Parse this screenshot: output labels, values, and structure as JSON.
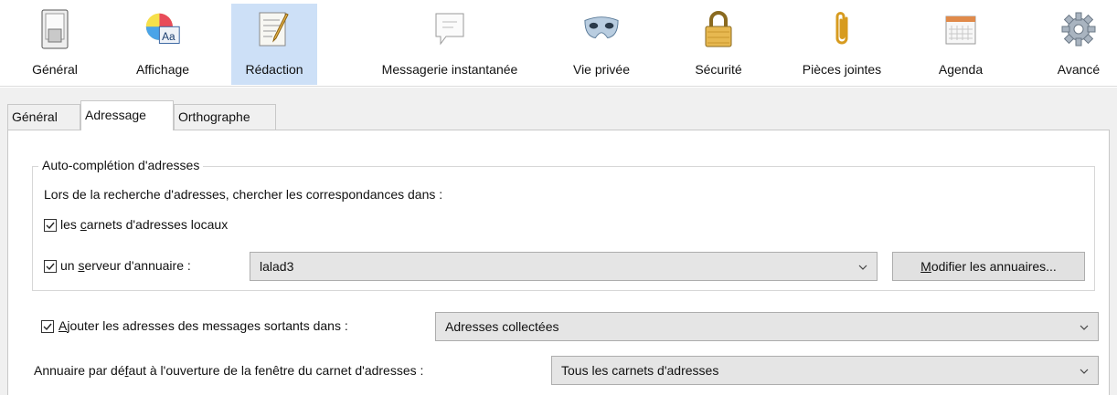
{
  "toolbar": {
    "items": [
      {
        "label": "Général",
        "icon": "general-icon"
      },
      {
        "label": "Affichage",
        "icon": "display-icon"
      },
      {
        "label": "Rédaction",
        "icon": "composition-icon",
        "selected": true
      },
      {
        "label": "Messagerie instantanée",
        "icon": "chat-icon"
      },
      {
        "label": "Vie privée",
        "icon": "privacy-mask-icon"
      },
      {
        "label": "Sécurité",
        "icon": "security-lock-icon"
      },
      {
        "label": "Pièces jointes",
        "icon": "attachment-clip-icon"
      },
      {
        "label": "Agenda",
        "icon": "calendar-icon"
      },
      {
        "label": "Avancé",
        "icon": "advanced-gear-icon"
      }
    ]
  },
  "tabs": [
    {
      "label": "Général"
    },
    {
      "label": "Adressage",
      "active": true
    },
    {
      "label": "Orthographe"
    }
  ],
  "autocomplete": {
    "title": "Auto-complétion d'adresses",
    "description": "Lors de la recherche d'adresses, chercher les correspondances dans :",
    "local_pre": "les ",
    "local_key": "c",
    "local_post": "arnets d'adresses locaux",
    "local_checked": true,
    "server_pre": "un ",
    "server_key": "s",
    "server_post": "erveur d'annuaire :",
    "server_checked": true,
    "server_value": "lalad3",
    "modify_key": "M",
    "modify_rest": "odifier les annuaires..."
  },
  "outgoing": {
    "key": "A",
    "rest": "jouter les adresses des messages sortants dans :",
    "checked": true,
    "value": "Adresses collectées"
  },
  "default_book": {
    "pre": "Annuaire par dé",
    "key": "f",
    "post": "aut à l'ouverture de la fenêtre du carnet d'adresses :",
    "value": "Tous les carnets d'adresses"
  },
  "colors": {
    "selected_toolbar": "#cde0f7",
    "panel_bg": "#f0f0f0"
  }
}
